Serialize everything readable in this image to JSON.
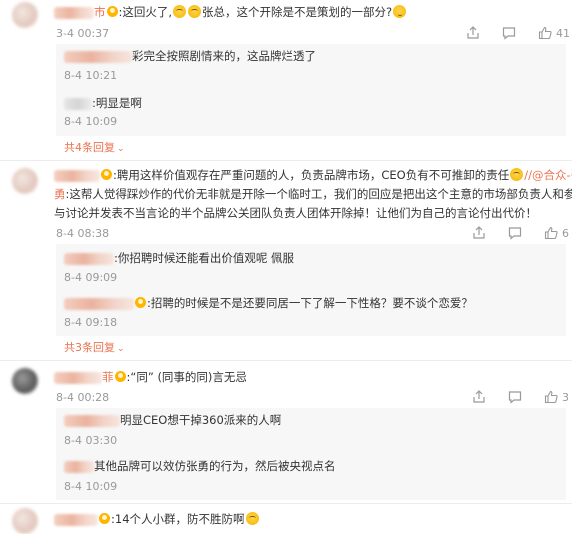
{
  "comments": [
    {
      "name_suffix": "市",
      "text_a": ":这回火了,",
      "text_b": "张总，这个开除是不是策划的一部分?",
      "time": "3-4 00:37",
      "like_count": "41",
      "replies": [
        {
          "text": "彩完全按照剧情来的，这品牌烂透了",
          "time": "8-4 10:21"
        },
        {
          "text": ":明显是啊",
          "time": "8-4 10:09"
        }
      ],
      "more_label": "共4条回复"
    },
    {
      "line1": ":聘用这样价值观存在严重问题的人，负责品牌市场，CEO负有不可推卸的责任",
      "mention": "//@合众-张",
      "line2_name": "勇",
      "line2": ":这帮人觉得踩炒作的代价无非就是开除一个临时工，我们的回应是把出这个主意的市场部负责人和参",
      "line3": "与讨论并发表不当言论的半个品牌公关团队负责人团体开除掉！让他们为自己的言论付出代价！",
      "time": "8-4 08:38",
      "like_count": "6",
      "replies": [
        {
          "text": ":你招聘时候还能看出价值观呢 佩服",
          "time": "8-4 09:09"
        },
        {
          "text": ":招聘的时候是不是还要同居一下了解一下性格？要不谈个恋爱？",
          "time": "8-4 09:18"
        }
      ],
      "more_label": "共3条回复"
    },
    {
      "name_suffix": "菲",
      "text": ":“同” (同事的同)言无忌",
      "time": "8-4 00:28",
      "like_count": "3",
      "replies": [
        {
          "text": "明显CEO想干掉360派来的人啊",
          "time": "8-4 03:30"
        },
        {
          "text": "其他品牌可以效仿张勇的行为，然后被央视点名",
          "time": "8-4 10:09"
        }
      ]
    },
    {
      "text_a": ":14个人小群，防不胜防啊",
      "time": ""
    }
  ],
  "icons": {
    "share": "share-icon",
    "comment": "comment-icon",
    "like": "thumbs-up-icon"
  },
  "colors": {
    "accent": "#eb7350",
    "muted": "#999999"
  }
}
